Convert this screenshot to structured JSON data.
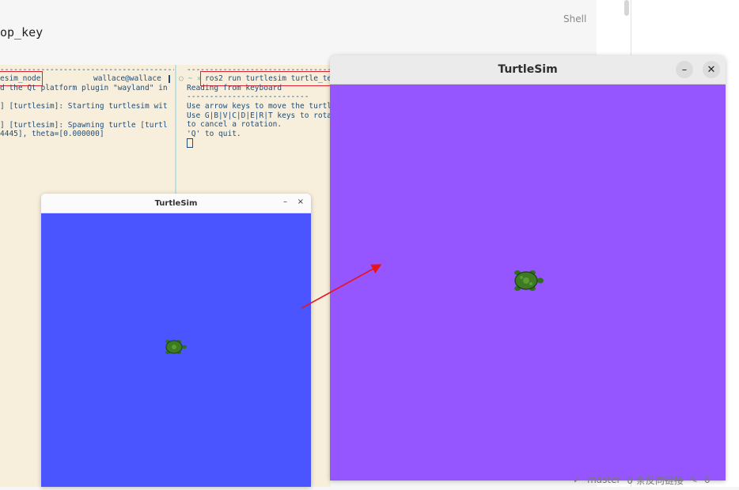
{
  "editor": {
    "heading_fragment": "op_key",
    "shell_label": "Shell"
  },
  "terminal": {
    "left_pane": {
      "dashes": "------------------------------------------------",
      "command": "esim_node",
      "user_host": "wallace@wallace",
      "lines": [
        "d the Qt platform plugin \"wayland\" in",
        "",
        "] [turtlesim]: Starting turtlesim wit",
        "",
        "] [turtlesim]: Spawning turtle [turtl",
        "4445], theta=[0.000000]"
      ]
    },
    "right_pane": {
      "dashes": "--------------------------------------------",
      "prompt": "○ ~ »",
      "command": "ros2 run turtlesim turtle_te",
      "lines": [
        "Reading from keyboard",
        "---------------------------",
        "Use arrow keys to move the turtl",
        "Use G|B|V|C|D|E|R|T keys to rota",
        "to cancel a rotation.",
        "'Q' to quit."
      ]
    }
  },
  "small_window": {
    "title": "TurtleSim",
    "minimize": "–",
    "close": "×",
    "bg_color": "#4a55ff"
  },
  "large_window": {
    "title": "TurtleSim",
    "minimize": "–",
    "close": "✕",
    "bg_color": "#9656ff"
  },
  "annotation": {
    "arrow_color": "#e8141c"
  },
  "status_bar": {
    "check": "✓",
    "branch": "master",
    "backlinks": "0 条反向链接",
    "count": "6"
  }
}
